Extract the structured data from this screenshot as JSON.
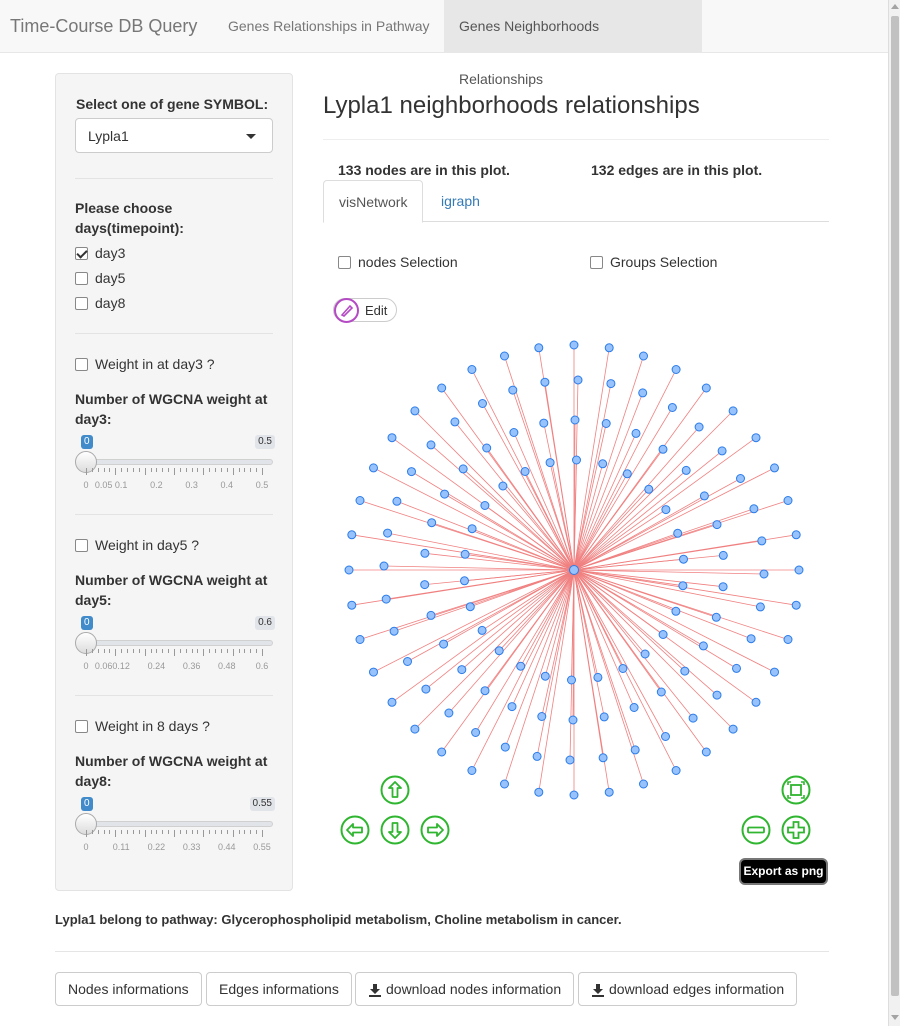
{
  "navbar": {
    "brand": "Time-Course DB Query",
    "tabs": [
      {
        "label": "Genes Relationships in Pathway",
        "active": false
      },
      {
        "label": "Genes Neighborhoods Relationships",
        "active": true
      }
    ]
  },
  "sidebar": {
    "gene_label": "Select one of gene SYMBOL:",
    "gene_selected": "Lypla1",
    "days_label_1": "Please choose",
    "days_label_2": "days(timepoint):",
    "days": [
      {
        "label": "day3",
        "checked": true
      },
      {
        "label": "day5",
        "checked": false
      },
      {
        "label": "day8",
        "checked": false
      }
    ],
    "weights": [
      {
        "checkbox_label": "Weight in at day3 ?",
        "slider_label_1": "Number of WGCNA weight at",
        "slider_label_2": "day3:",
        "value": "0",
        "max": "0.5",
        "ticks": [
          "0",
          "0.05",
          "0.1",
          "0.2",
          "0.3",
          "0.4",
          "0.5"
        ]
      },
      {
        "checkbox_label": "Weight in day5 ?",
        "slider_label_1": "Number of WGCNA weight at",
        "slider_label_2": "day5:",
        "value": "0",
        "max": "0.6",
        "ticks": [
          "0",
          "0.06",
          "0.12",
          "0.24",
          "0.36",
          "0.48",
          "0.6"
        ]
      },
      {
        "checkbox_label": "Weight in 8 days ?",
        "slider_label_1": "Number of WGCNA weight at",
        "slider_label_2": "day8:",
        "value": "0",
        "max": "0.55",
        "ticks": [
          "0",
          "0.11",
          "0.22",
          "0.33",
          "0.44",
          "0.55"
        ]
      }
    ]
  },
  "main": {
    "title": "Lypla1 neighborhoods relationships",
    "nodes_count": "133 nodes are in this plot.",
    "edges_count": "132 edges are in this plot.",
    "tabs": [
      {
        "label": "visNetwork",
        "active": true
      },
      {
        "label": "igraph",
        "active": false
      }
    ],
    "nodes_selection": "nodes Selection",
    "groups_selection": "Groups Selection",
    "edit_label": "Edit",
    "export_label": "Export as png",
    "pathway_text": "Lypla1 belong to pathway: Glycerophospholipid metabolism, Choline metabolism in cancer.",
    "buttons": [
      {
        "label": "Nodes informations"
      },
      {
        "label": "Edges informations"
      },
      {
        "label": "download nodes information"
      },
      {
        "label": "download edges information"
      }
    ]
  },
  "colors": {
    "node_fill": "#97c2fc",
    "node_stroke": "#2b7ce9",
    "edge": "#f08080",
    "nav_green": "#2fb52f",
    "slider_blue": "#428bca"
  }
}
